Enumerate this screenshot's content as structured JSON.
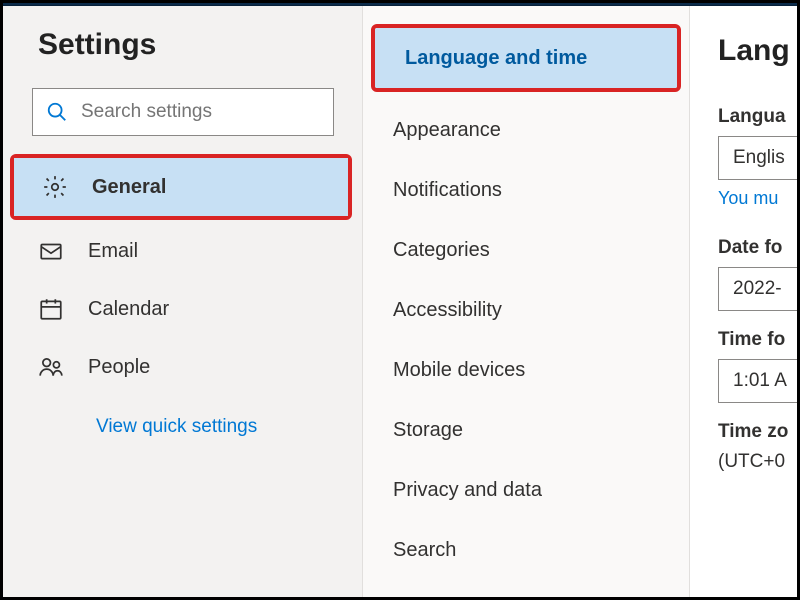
{
  "sidebar": {
    "title": "Settings",
    "search_placeholder": "Search settings",
    "items": [
      {
        "label": "General"
      },
      {
        "label": "Email"
      },
      {
        "label": "Calendar"
      },
      {
        "label": "People"
      }
    ],
    "quick_link": "View quick settings"
  },
  "subnav": {
    "items": [
      {
        "label": "Language and time"
      },
      {
        "label": "Appearance"
      },
      {
        "label": "Notifications"
      },
      {
        "label": "Categories"
      },
      {
        "label": "Accessibility"
      },
      {
        "label": "Mobile devices"
      },
      {
        "label": "Storage"
      },
      {
        "label": "Privacy and data"
      },
      {
        "label": "Search"
      }
    ]
  },
  "content": {
    "title": "Lang",
    "language_label": "Langua",
    "language_value": "Englis",
    "language_hint": "You mu",
    "date_label": "Date fo",
    "date_value": "2022-",
    "time_label": "Time fo",
    "time_value": "1:01 A",
    "tz_label": "Time zo",
    "tz_value": "(UTC+0"
  }
}
